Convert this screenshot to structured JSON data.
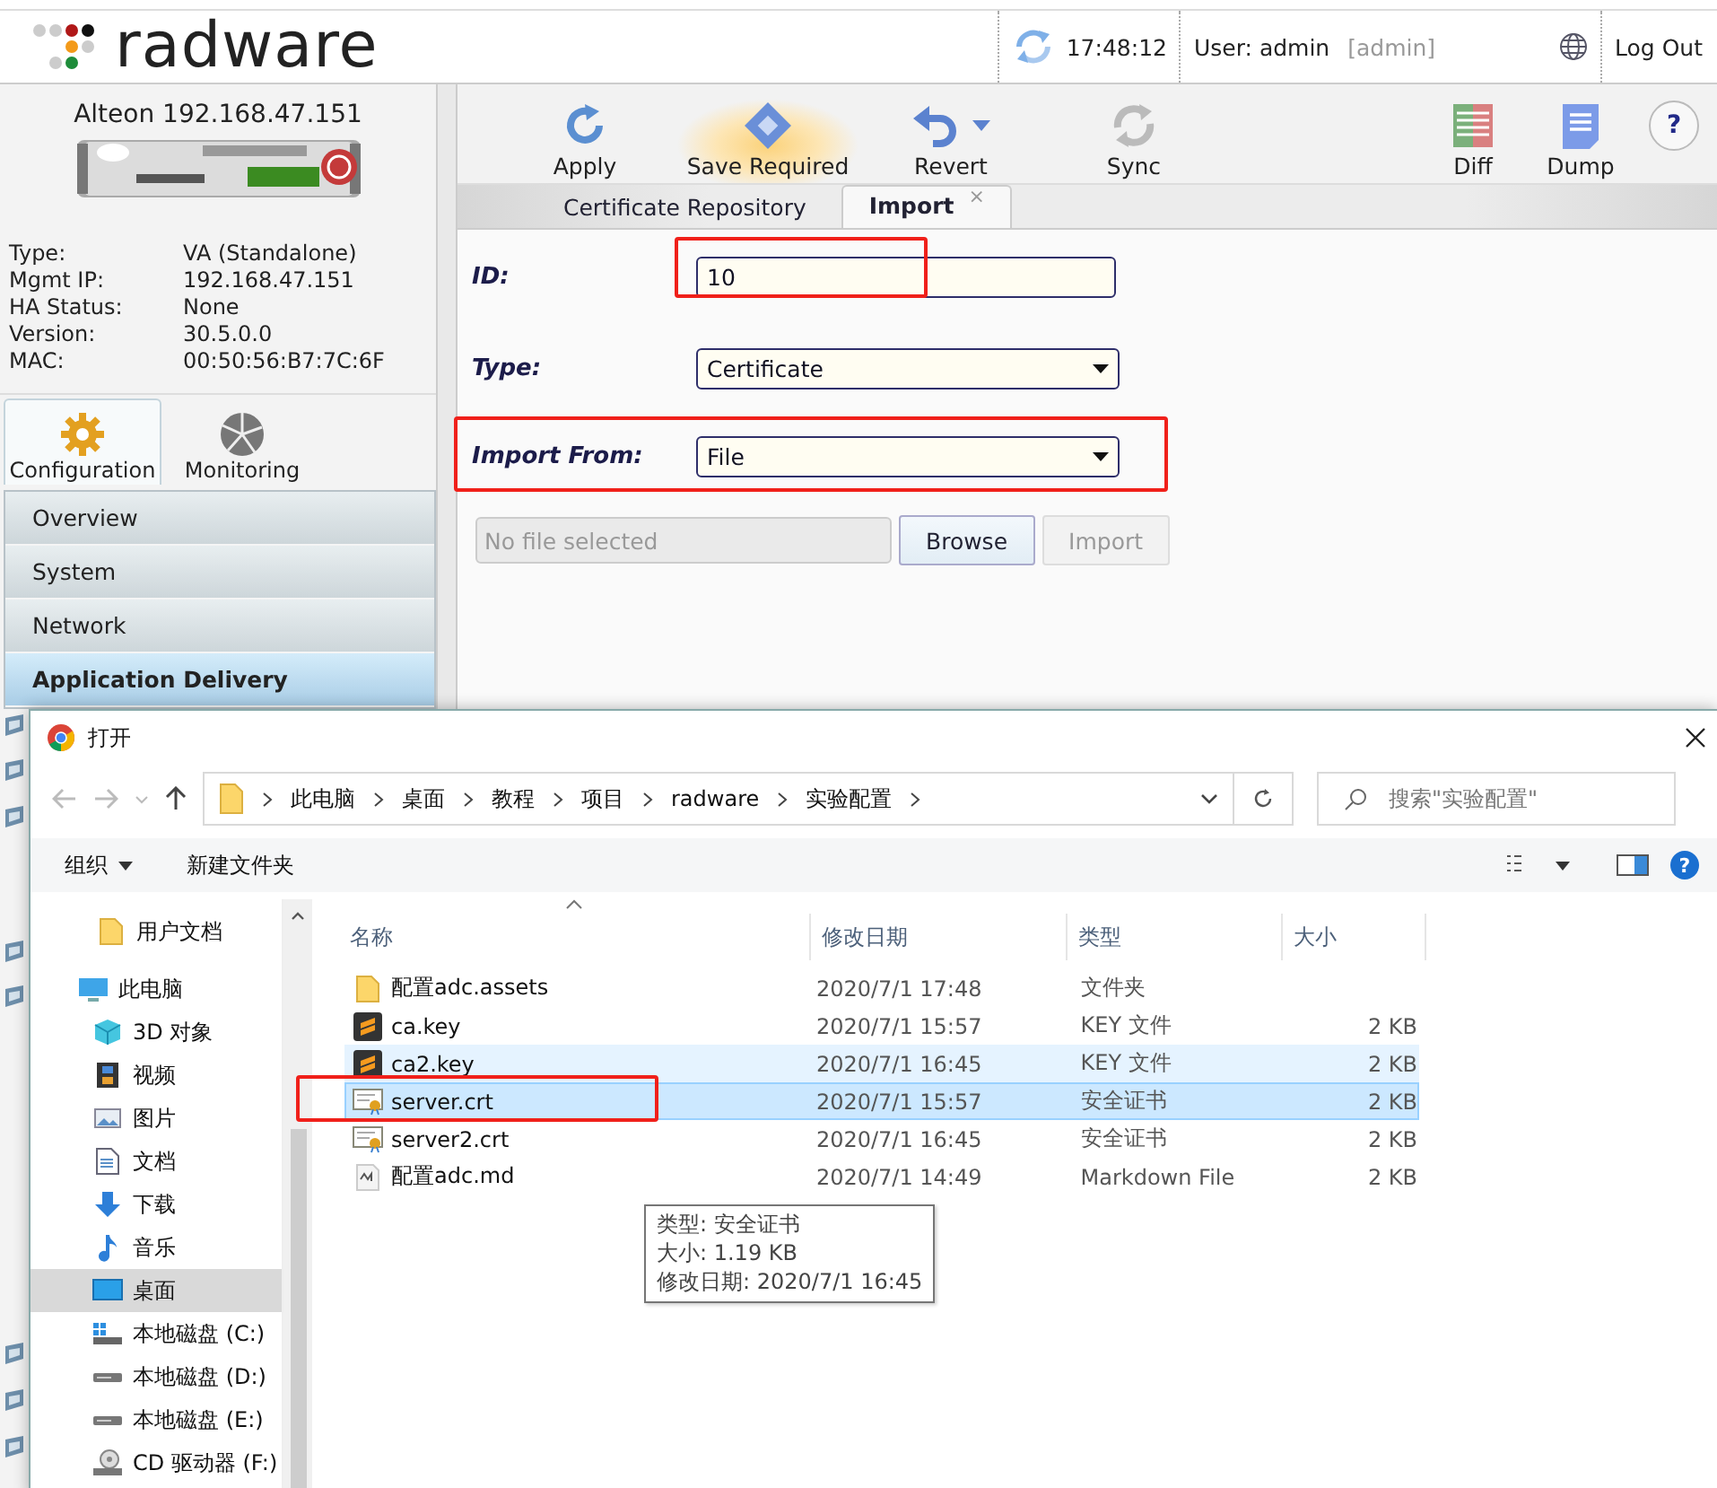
{
  "header": {
    "logo": "radware",
    "time": "17:48:12",
    "user": "User: admin",
    "role": "[admin]",
    "logout": "Log Out"
  },
  "device": {
    "title": "Alteon 192.168.47.151",
    "info": [
      {
        "label": "Type:",
        "value": "VA (Standalone)"
      },
      {
        "label": "Mgmt IP:",
        "value": "192.168.47.151"
      },
      {
        "label": "HA Status:",
        "value": "None"
      },
      {
        "label": "Version:",
        "value": "30.5.0.0"
      },
      {
        "label": "MAC:",
        "value": "00:50:56:B7:7C:6F"
      }
    ]
  },
  "mode_tabs": [
    {
      "label": "Configuration",
      "kind": "gear",
      "selected": true
    },
    {
      "label": "Monitoring",
      "kind": "pie",
      "selected": false
    }
  ],
  "nav": [
    {
      "label": "Overview",
      "selected": false
    },
    {
      "label": "System",
      "selected": false
    },
    {
      "label": "Network",
      "selected": false
    },
    {
      "label": "Application Delivery",
      "selected": true
    }
  ],
  "toolbar": [
    {
      "label": "Apply",
      "kind": "apply",
      "disabled": false,
      "alert": false
    },
    {
      "label": "Save Required",
      "kind": "save",
      "disabled": false,
      "alert": true
    },
    {
      "label": "Revert",
      "kind": "revert",
      "disabled": false,
      "alert": false
    },
    {
      "label": "Sync",
      "kind": "sync",
      "disabled": true,
      "alert": false
    }
  ],
  "toolbar_right": [
    {
      "label": "Diff",
      "kind": "diff",
      "disabled": false,
      "alert": false
    },
    {
      "label": "Dump",
      "kind": "dump",
      "disabled": false,
      "alert": false
    }
  ],
  "help": "?",
  "content_tabs": [
    {
      "label": "Certificate Repository",
      "selected": false
    },
    {
      "label": "Import",
      "selected": true,
      "close": "×"
    }
  ],
  "form": {
    "fields": [
      {
        "label": "ID:",
        "kind": "text",
        "value": "10",
        "highlighted": true
      },
      {
        "label": "Type:",
        "kind": "select",
        "value": "Certificate",
        "highlighted": false
      },
      {
        "label": "Import From:",
        "kind": "select",
        "value": "File",
        "highlighted": true
      }
    ],
    "file": {
      "placeholder": "No file selected"
    },
    "browse": {
      "label": "Browse",
      "disabled": false
    },
    "import": {
      "label": "Import",
      "disabled": true
    }
  },
  "dialog": {
    "title": "打开",
    "path": [
      "此电脑",
      "桌面",
      "教程",
      "项目",
      "radware",
      "实验配置"
    ],
    "search": {
      "placeholder": "搜索\"实验配置\""
    },
    "commands": [
      {
        "label": "组织",
        "menu": true
      },
      {
        "label": "新建文件夹",
        "menu": false
      }
    ],
    "help": "?",
    "tree": [
      {
        "label": "用户文档",
        "kind": "folder",
        "selected": false
      },
      {
        "label": "此电脑",
        "kind": "pc",
        "selected": false,
        "children": [
          {
            "label": "3D 对象",
            "kind": "cube",
            "selected": false
          },
          {
            "label": "视频",
            "kind": "video",
            "selected": false
          },
          {
            "label": "图片",
            "kind": "pictures",
            "selected": false
          },
          {
            "label": "文档",
            "kind": "document",
            "selected": false
          },
          {
            "label": "下载",
            "kind": "download",
            "selected": false
          },
          {
            "label": "音乐",
            "kind": "music",
            "selected": false
          },
          {
            "label": "桌面",
            "kind": "desktop",
            "selected": true
          },
          {
            "label": "本地磁盘 (C:)",
            "kind": "system-drive",
            "selected": false
          },
          {
            "label": "本地磁盘 (D:)",
            "kind": "drive",
            "selected": false
          },
          {
            "label": "本地磁盘 (E:)",
            "kind": "drive",
            "selected": false
          },
          {
            "label": "CD 驱动器 (F:)",
            "kind": "cd",
            "selected": false
          }
        ]
      }
    ],
    "columns": [
      "名称",
      "修改日期",
      "类型",
      "大小"
    ],
    "files": [
      {
        "name": "配置adc.assets",
        "kind": "folder",
        "date": "2020/7/1 17:48",
        "type": "文件夹",
        "selected": false,
        "hovered": false,
        "annotated": false
      },
      {
        "name": "ca.key",
        "kind": "key",
        "date": "2020/7/1 15:57",
        "type": "KEY 文件",
        "size": "2 KB",
        "selected": false,
        "hovered": false,
        "annotated": false
      },
      {
        "name": "ca2.key",
        "kind": "key",
        "date": "2020/7/1 16:45",
        "type": "KEY 文件",
        "size": "2 KB",
        "selected": false,
        "hovered": true,
        "annotated": false
      },
      {
        "name": "server.crt",
        "kind": "certificate",
        "date": "2020/7/1 15:57",
        "type": "安全证书",
        "size": "2 KB",
        "selected": true,
        "hovered": false,
        "annotated": true
      },
      {
        "name": "server2.crt",
        "kind": "certificate",
        "date": "2020/7/1 16:45",
        "type": "安全证书",
        "size": "2 KB",
        "selected": false,
        "hovered": false,
        "annotated": false
      },
      {
        "name": "配置adc.md",
        "kind": "markdown",
        "date": "2020/7/1 14:49",
        "type": "Markdown File",
        "size": "2 KB",
        "selected": false,
        "hovered": false,
        "annotated": false
      }
    ],
    "tooltip": [
      "类型: 安全证书",
      "大小: 1.19 KB",
      "修改日期: 2020/7/1 16:45"
    ]
  }
}
